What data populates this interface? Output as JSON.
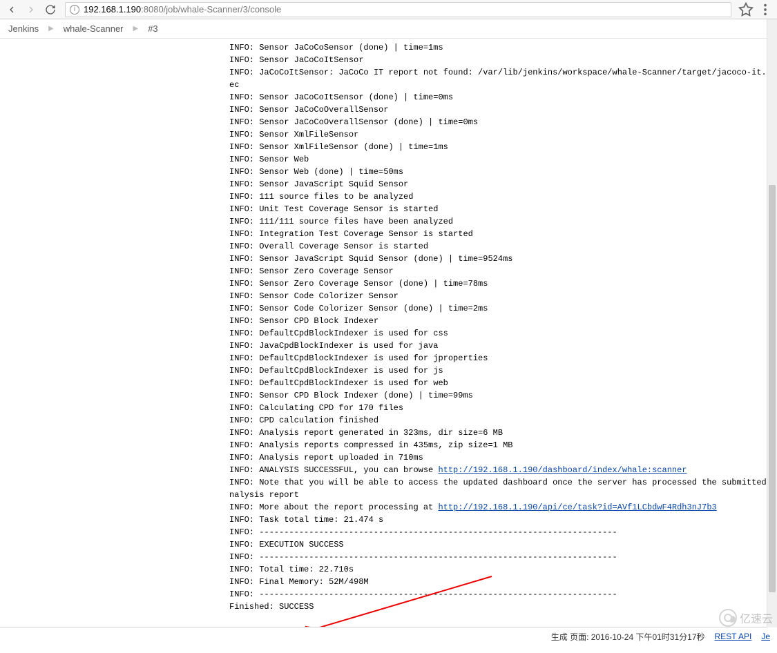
{
  "url": {
    "host": "192.168.1.190",
    "path": ":8080/job/whale-Scanner/3/console"
  },
  "breadcrumb": {
    "items": [
      "Jenkins",
      "whale-Scanner",
      "#3"
    ]
  },
  "console": {
    "lines": [
      "INFO: Sensor JaCoCoSensor (done) | time=1ms",
      "INFO: Sensor JaCoCoItSensor",
      "INFO: JaCoCoItSensor: JaCoCo IT report not found: /var/lib/jenkins/workspace/whale-Scanner/target/jacoco-it.exec",
      "INFO: Sensor JaCoCoItSensor (done) | time=0ms",
      "INFO: Sensor JaCoCoOverallSensor",
      "INFO: Sensor JaCoCoOverallSensor (done) | time=0ms",
      "INFO: Sensor XmlFileSensor",
      "INFO: Sensor XmlFileSensor (done) | time=1ms",
      "INFO: Sensor Web",
      "INFO: Sensor Web (done) | time=50ms",
      "INFO: Sensor JavaScript Squid Sensor",
      "INFO: 111 source files to be analyzed",
      "INFO: Unit Test Coverage Sensor is started",
      "INFO: 111/111 source files have been analyzed",
      "INFO: Integration Test Coverage Sensor is started",
      "INFO: Overall Coverage Sensor is started",
      "INFO: Sensor JavaScript Squid Sensor (done) | time=9524ms",
      "INFO: Sensor Zero Coverage Sensor",
      "INFO: Sensor Zero Coverage Sensor (done) | time=78ms",
      "INFO: Sensor Code Colorizer Sensor",
      "INFO: Sensor Code Colorizer Sensor (done) | time=2ms",
      "INFO: Sensor CPD Block Indexer",
      "INFO: DefaultCpdBlockIndexer is used for css",
      "INFO: JavaCpdBlockIndexer is used for java",
      "INFO: DefaultCpdBlockIndexer is used for jproperties",
      "INFO: DefaultCpdBlockIndexer is used for js",
      "INFO: DefaultCpdBlockIndexer is used for web",
      "INFO: Sensor CPD Block Indexer (done) | time=99ms",
      "INFO: Calculating CPD for 170 files",
      "INFO: CPD calculation finished",
      "INFO: Analysis report generated in 323ms, dir size=6 MB",
      "INFO: Analysis reports compressed in 435ms, zip size=1 MB",
      "INFO: Analysis report uploaded in 710ms"
    ],
    "success_prefix": "INFO: ANALYSIS SUCCESSFUL, you can browse ",
    "link1": "http://192.168.1.190/dashboard/index/whale:scanner",
    "note": "INFO: Note that you will be able to access the updated dashboard once the server has processed the submitted analysis report",
    "more_prefix": "INFO: More about the report processing at ",
    "link2": "http://192.168.1.190/api/ce/task?id=AVf1LCbdwF4Rdh3nJ7b3",
    "tail": [
      "INFO: Task total time: 21.474 s",
      "INFO: ------------------------------------------------------------------------",
      "INFO: EXECUTION SUCCESS",
      "INFO: ------------------------------------------------------------------------",
      "INFO: Total time: 22.710s",
      "INFO: Final Memory: 52M/498M",
      "INFO: ------------------------------------------------------------------------",
      "Finished: SUCCESS"
    ]
  },
  "footer": {
    "gen_label": "生成 页面: 2016-10-24 下午01时31分17秒",
    "rest_api": "REST API",
    "jenkins": "Je"
  },
  "watermark": "亿速云"
}
